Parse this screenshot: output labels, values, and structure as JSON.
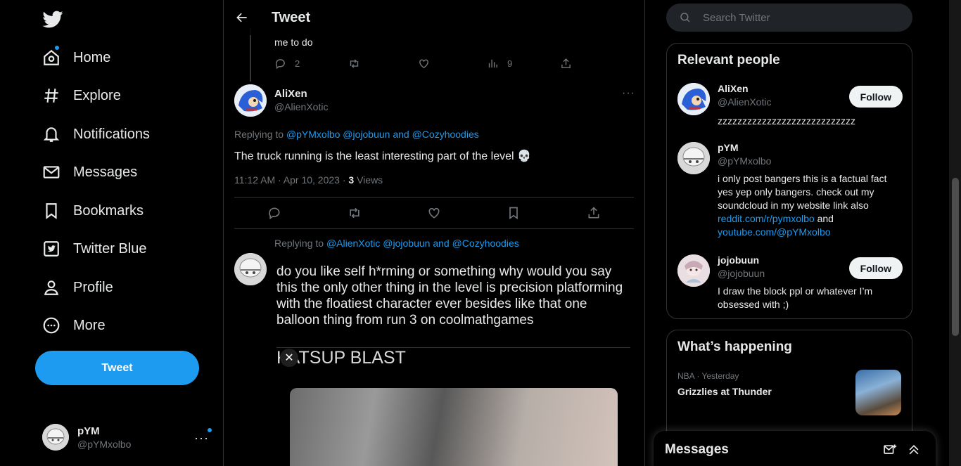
{
  "nav": {
    "items": [
      {
        "label": "Home"
      },
      {
        "label": "Explore"
      },
      {
        "label": "Notifications"
      },
      {
        "label": "Messages"
      },
      {
        "label": "Bookmarks"
      },
      {
        "label": "Twitter Blue"
      },
      {
        "label": "Profile"
      },
      {
        "label": "More"
      }
    ],
    "tweet_button": "Tweet",
    "account": {
      "display_name": "pYM",
      "handle": "@pYMxolbo",
      "more": "···"
    }
  },
  "header": {
    "title": "Tweet"
  },
  "prev_tweet": {
    "text_tail": "me to do",
    "replies": "2",
    "views": "9"
  },
  "tweet": {
    "display_name": "AliXen",
    "handle": "@AlienXotic",
    "more": "···",
    "replying_prefix": "Replying to",
    "replying_to": "@pYMxolbo @jojobuun and @Cozyhoodies",
    "text": "The truck running is the least interesting part of the level 💀",
    "time": "11:12 AM · Apr 10, 2023 · ",
    "views_count": "3",
    "views_label": " Views"
  },
  "reply": {
    "replying_prefix": "Replying to",
    "replying_to": "@AlienXotic @jojobuun and @Cozyhoodies",
    "text": "do you like self h*rming or something why would you say this the only other thing in the level is precision platforming with the floatiest character ever besides like that one balloon thing from run 3 on coolmathgames",
    "media_caption": "KATSUP BLAST",
    "close": "✕"
  },
  "search": {
    "placeholder": "Search Twitter"
  },
  "relevant": {
    "title": "Relevant people",
    "people": [
      {
        "display_name": "AliXen",
        "handle": "@AlienXotic",
        "bio": "zzzzzzzzzzzzzzzzzzzzzzzzzzzz",
        "follow": "Follow"
      },
      {
        "display_name": "pYM",
        "handle": "@pYMxolbo",
        "bio_text": "i only post bangers this is a factual fact yes yep only bangers. check out my soundcloud in my website link also",
        "bio_link1": "reddit.com/r/pymxolbo",
        "bio_and": " and ",
        "bio_link2": "youtube.com/@pYMxolbo"
      },
      {
        "display_name": "jojobuun",
        "handle": "@jojobuun",
        "bio": "I draw the block ppl or whatever I’m obsessed with ;)",
        "follow": "Follow"
      }
    ]
  },
  "happening": {
    "title": "What’s happening",
    "trend_meta": "NBA · Yesterday",
    "trend_title": "Grizzlies at Thunder"
  },
  "messages_drawer": {
    "title": "Messages"
  },
  "colors": {
    "accent": "#1d9bf0",
    "background": "#000000",
    "muted": "#71767b"
  }
}
